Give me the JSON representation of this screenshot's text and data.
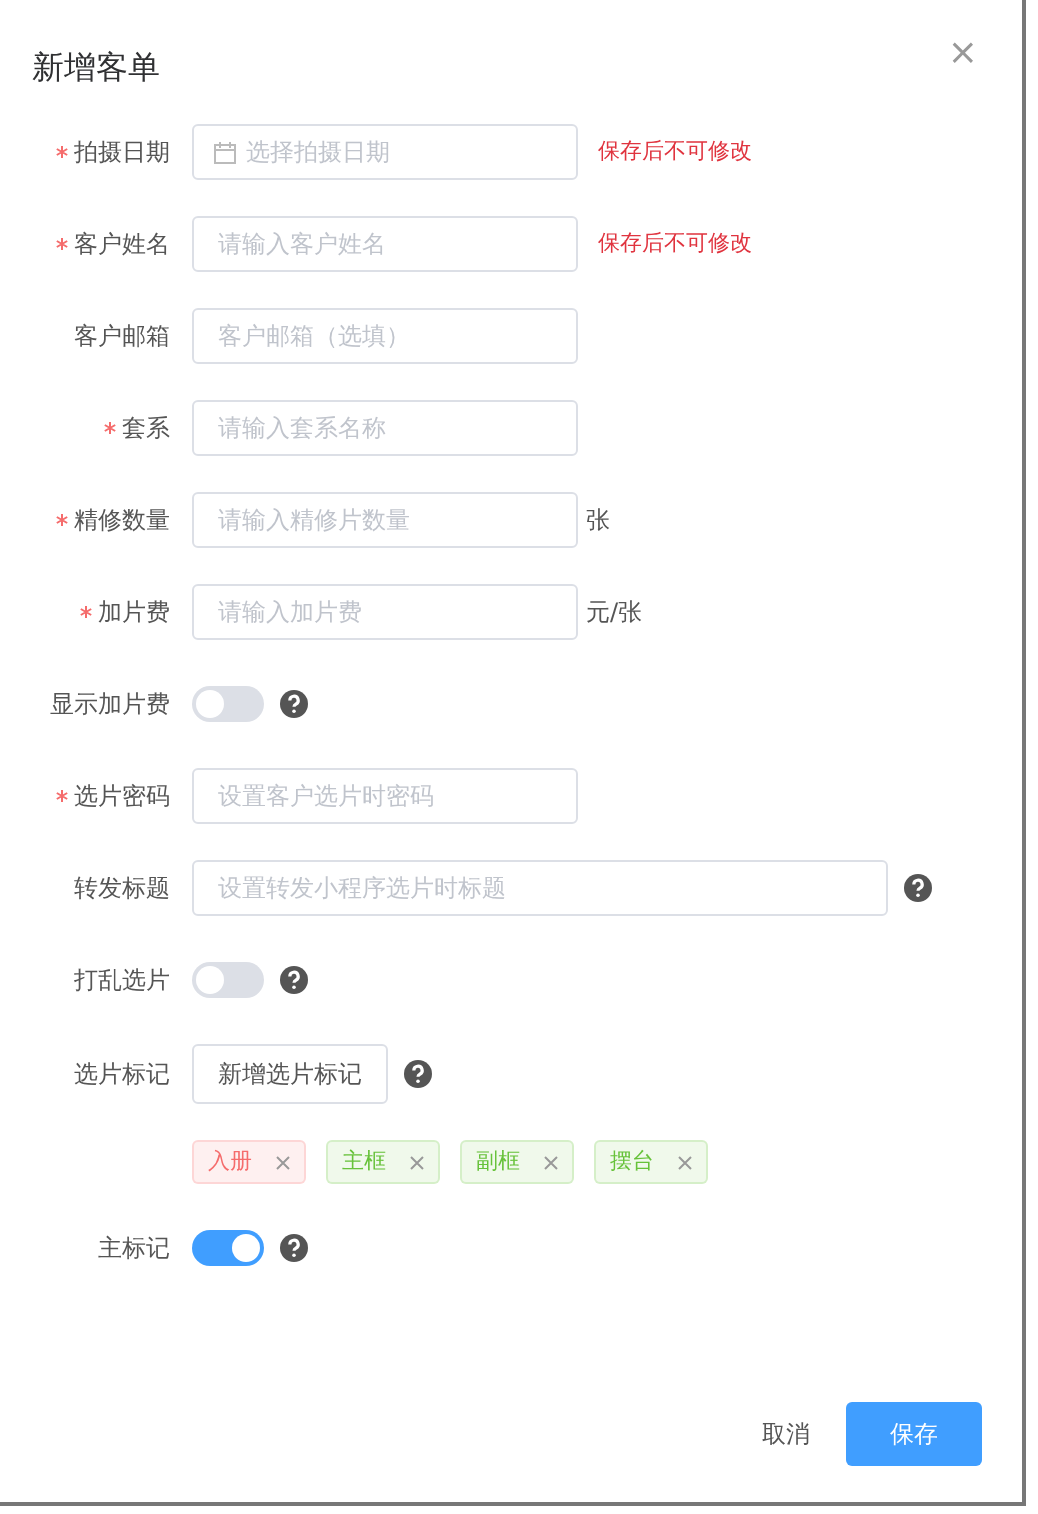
{
  "dialog": {
    "title": "新增客单",
    "close": "×"
  },
  "fields": [
    {
      "kind": "input",
      "label": "拍摄日期",
      "required": true,
      "placeholder": "选择拍摄日期",
      "calendar": true,
      "note": "保存后不可修改"
    },
    {
      "kind": "input",
      "label": "客户姓名",
      "required": true,
      "placeholder": "请输入客户姓名",
      "note": "保存后不可修改"
    },
    {
      "kind": "input",
      "label": "客户邮箱",
      "required": false,
      "placeholder": "客户邮箱（选填）"
    },
    {
      "kind": "input",
      "label": "套系",
      "required": true,
      "placeholder": "请输入套系名称"
    },
    {
      "kind": "input",
      "label": "精修数量",
      "required": true,
      "placeholder": "请输入精修片数量",
      "suffix": "张"
    },
    {
      "kind": "input",
      "label": "加片费",
      "required": true,
      "placeholder": "请输入加片费",
      "suffix": "元/张"
    },
    {
      "kind": "switch",
      "label": "显示加片费",
      "on": false,
      "help": true
    },
    {
      "kind": "input",
      "label": "选片密码",
      "required": true,
      "placeholder": "设置客户选片时密码"
    },
    {
      "kind": "input",
      "label": "转发标题",
      "required": false,
      "placeholder": "设置转发小程序选片时标题",
      "wide": true,
      "help": true
    },
    {
      "kind": "switch",
      "label": "打乱选片",
      "on": false,
      "help": true
    },
    {
      "kind": "button",
      "label": "选片标记",
      "text": "新增选片标记",
      "help": true
    },
    {
      "kind": "tags",
      "tags": [
        {
          "text": "入册",
          "color": "#f56c6c"
        },
        {
          "text": "主框",
          "color": "#67c23a"
        },
        {
          "text": "副框",
          "color": "#67c23a"
        },
        {
          "text": "摆台",
          "color": "#67c23a"
        }
      ]
    },
    {
      "kind": "switch",
      "label": "主标记",
      "on": true,
      "help": true
    }
  ],
  "footer": {
    "cancel": "取消",
    "save": "保存"
  }
}
